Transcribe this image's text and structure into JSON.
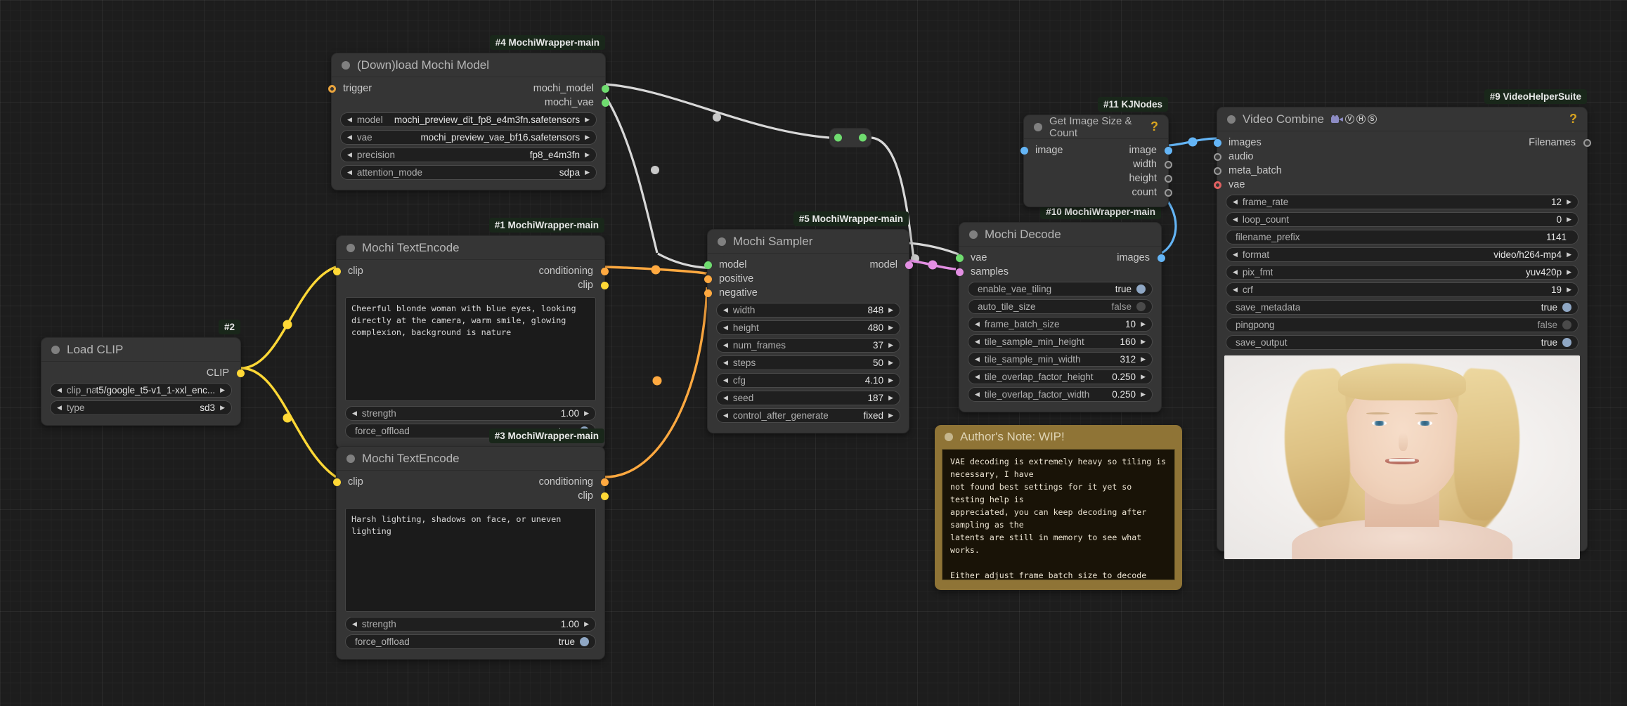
{
  "canvas": {
    "background": "#1d1d1d"
  },
  "link_colors": {
    "model": "#d8d8d8",
    "clip": "#ffd836",
    "conditioning": "#ffa940",
    "latent": "#e38fe3",
    "image": "#64b5f6",
    "vae": "#ff6e6e"
  },
  "nodes": {
    "load_mochi": {
      "badge": "#4 MochiWrapper-main",
      "title": "(Down)load Mochi Model",
      "inputs": [
        {
          "name": "trigger",
          "type": "ring-orange"
        }
      ],
      "outputs": [
        {
          "name": "mochi_model",
          "color": "#6fdc6f"
        },
        {
          "name": "mochi_vae",
          "color": "#6fdc6f"
        }
      ],
      "widgets": [
        {
          "name": "model",
          "value": "mochi_preview_dit_fp8_e4m3fn.safetensors",
          "kind": "combo"
        },
        {
          "name": "vae",
          "value": "mochi_preview_vae_bf16.safetensors",
          "kind": "combo"
        },
        {
          "name": "precision",
          "value": "fp8_e4m3fn",
          "kind": "combo"
        },
        {
          "name": "attention_mode",
          "value": "sdpa",
          "kind": "combo"
        }
      ]
    },
    "load_clip": {
      "badge": "#2",
      "title": "Load CLIP",
      "outputs": [
        {
          "name": "CLIP",
          "color": "#ffd836"
        }
      ],
      "widgets": [
        {
          "name": "clip_name",
          "value": "t5/google_t5-v1_1-xxl_enc...",
          "kind": "combo"
        },
        {
          "name": "type",
          "value": "sd3",
          "kind": "combo"
        }
      ]
    },
    "text_encode_positive": {
      "badge": "#1 MochiWrapper-main",
      "title": "Mochi TextEncode",
      "inputs": [
        {
          "name": "clip",
          "color": "#ffd836"
        }
      ],
      "outputs": [
        {
          "name": "conditioning",
          "color": "#ffa940"
        },
        {
          "name": "clip",
          "color": "#ffd836"
        }
      ],
      "prompt": "Cheerful blonde woman with blue eyes, looking directly at the camera, warm smile, glowing complexion, background is nature",
      "widgets": [
        {
          "name": "strength",
          "value": "1.00",
          "kind": "combo"
        },
        {
          "name": "force_offload",
          "value": "true",
          "kind": "toggle"
        }
      ]
    },
    "text_encode_negative": {
      "badge": "#3 MochiWrapper-main",
      "title": "Mochi TextEncode",
      "inputs": [
        {
          "name": "clip",
          "color": "#ffd836"
        }
      ],
      "outputs": [
        {
          "name": "conditioning",
          "color": "#ffa940"
        },
        {
          "name": "clip",
          "color": "#ffd836"
        }
      ],
      "prompt": "Harsh lighting, shadows on face, or uneven lighting",
      "widgets": [
        {
          "name": "strength",
          "value": "1.00",
          "kind": "combo"
        },
        {
          "name": "force_offload",
          "value": "true",
          "kind": "toggle"
        }
      ]
    },
    "mochi_sampler": {
      "badge": "#5 MochiWrapper-main",
      "title": "Mochi Sampler",
      "inputs": [
        {
          "name": "model",
          "color": "#6fdc6f"
        },
        {
          "name": "positive",
          "color": "#ffa940"
        },
        {
          "name": "negative",
          "color": "#ffa940"
        }
      ],
      "outputs": [
        {
          "name": "model",
          "color": "#e38fe3"
        }
      ],
      "widgets": [
        {
          "name": "width",
          "value": "848",
          "kind": "combo"
        },
        {
          "name": "height",
          "value": "480",
          "kind": "combo"
        },
        {
          "name": "num_frames",
          "value": "37",
          "kind": "combo"
        },
        {
          "name": "steps",
          "value": "50",
          "kind": "combo"
        },
        {
          "name": "cfg",
          "value": "4.10",
          "kind": "combo"
        },
        {
          "name": "seed",
          "value": "187",
          "kind": "combo"
        },
        {
          "name": "control_after_generate",
          "value": "fixed",
          "kind": "combo"
        }
      ]
    },
    "mochi_decode": {
      "badge": "#10 MochiWrapper-main",
      "title": "Mochi Decode",
      "inputs": [
        {
          "name": "vae",
          "color": "#6fdc6f"
        },
        {
          "name": "samples",
          "color": "#e38fe3"
        }
      ],
      "outputs": [
        {
          "name": "images",
          "color": "#64b5f6"
        }
      ],
      "widgets": [
        {
          "name": "enable_vae_tiling",
          "value": "true",
          "kind": "toggle"
        },
        {
          "name": "auto_tile_size",
          "value": "false",
          "kind": "toggle-off"
        },
        {
          "name": "frame_batch_size",
          "value": "10",
          "kind": "combo"
        },
        {
          "name": "tile_sample_min_height",
          "value": "160",
          "kind": "combo"
        },
        {
          "name": "tile_sample_min_width",
          "value": "312",
          "kind": "combo"
        },
        {
          "name": "tile_overlap_factor_height",
          "value": "0.250",
          "kind": "combo"
        },
        {
          "name": "tile_overlap_factor_width",
          "value": "0.250",
          "kind": "combo"
        }
      ]
    },
    "get_image_size": {
      "badge": "#11 KJNodes",
      "title": "Get Image Size & Count",
      "help": "?",
      "inputs": [
        {
          "name": "image",
          "color": "#64b5f6"
        }
      ],
      "outputs": [
        {
          "name": "image",
          "color": "#64b5f6"
        },
        {
          "name": "width",
          "type": "hollow"
        },
        {
          "name": "height",
          "type": "hollow"
        },
        {
          "name": "count",
          "type": "hollow"
        }
      ]
    },
    "video_combine": {
      "badge": "#9 VideoHelperSuite",
      "title": "Video Combine",
      "title_icons": [
        "video-camera-icon",
        "V",
        "H",
        "S"
      ],
      "help": "?",
      "inputs": [
        {
          "name": "images",
          "color": "#64b5f6"
        },
        {
          "name": "audio",
          "type": "hollow"
        },
        {
          "name": "meta_batch",
          "type": "hollow"
        },
        {
          "name": "vae",
          "type": "ring-red"
        }
      ],
      "outputs": [
        {
          "name": "Filenames",
          "type": "hollow"
        }
      ],
      "widgets": [
        {
          "name": "frame_rate",
          "value": "12",
          "kind": "combo"
        },
        {
          "name": "loop_count",
          "value": "0",
          "kind": "combo"
        },
        {
          "name": "filename_prefix",
          "value": "1141",
          "kind": "text"
        },
        {
          "name": "format",
          "value": "video/h264-mp4",
          "kind": "combo"
        },
        {
          "name": "pix_fmt",
          "value": "yuv420p",
          "kind": "combo"
        },
        {
          "name": "crf",
          "value": "19",
          "kind": "combo"
        },
        {
          "name": "save_metadata",
          "value": "true",
          "kind": "toggle"
        },
        {
          "name": "pingpong",
          "value": "false",
          "kind": "toggle-off"
        },
        {
          "name": "save_output",
          "value": "true",
          "kind": "toggle"
        }
      ],
      "preview_alt": "blonde-woman-portrait-preview"
    },
    "authors_note": {
      "title": "Author's Note: WIP!",
      "text": "VAE decoding is extremely heavy so tiling is necessary, I have\nnot found best settings for it yet so testing help is\nappreciated, you can keep decoding after sampling as the\nlatents are still in memory to see what works.\n\nEither adjust frame_batch_size to decode less frames at once,\nthis tends to cause frame skipping though.\n\nOr use higher batch and smaller tiles to still fit it in\nmemory."
    }
  }
}
